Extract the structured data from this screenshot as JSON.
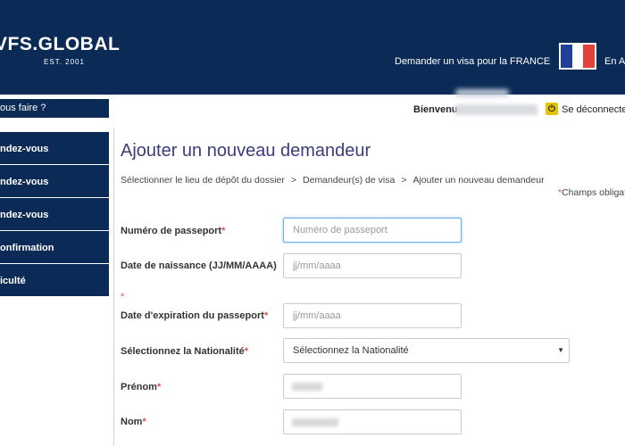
{
  "header": {
    "logo_text": "VFS.GLOBAL",
    "logo_sub": "EST. 2001",
    "cta": "Demander un visa pour la FRANCE",
    "lang": "En A",
    "flag_colors": [
      "#1f3f99",
      "#ffffff",
      "#e2403b"
    ],
    "bg_color": "#0b2a56"
  },
  "menu": {
    "top_label": "ous faire ?"
  },
  "sidebar": {
    "items": [
      {
        "label": "ndez-vous"
      },
      {
        "label": "ndez-vous"
      },
      {
        "label": "ndez-vous"
      },
      {
        "label": "onfirmation"
      },
      {
        "label": "iculté"
      }
    ]
  },
  "user": {
    "welcome": "Bienvenu",
    "logout_icon": "power-icon",
    "logout": "Se déconnecte"
  },
  "page": {
    "title": "Ajouter un nouveau demandeur",
    "breadcrumbs": [
      "Sélectionner le lieu de dépôt du dossier",
      "Demandeur(s) de visa",
      "Ajouter un nouveau demandeur"
    ],
    "breadcrumb_sep": ">",
    "required_note": "Champs obligat",
    "required_star": "*"
  },
  "form": {
    "passport": {
      "label": "Numéro de passeport",
      "placeholder": "Numéro de passeport"
    },
    "birth_date": {
      "label": "Date de naissance (JJ/MM/AAAA)",
      "placeholder": "jj/mm/aaaa"
    },
    "expiry": {
      "label": "Date d'expiration du passeport",
      "placeholder": "jj/mm/aaaa"
    },
    "nationality": {
      "label": "Sélectionnez la Nationalité",
      "selected": "Sélectionnez la Nationalité"
    },
    "first_name": {
      "label": "Prénom"
    },
    "last_name": {
      "label": "Nom"
    }
  }
}
